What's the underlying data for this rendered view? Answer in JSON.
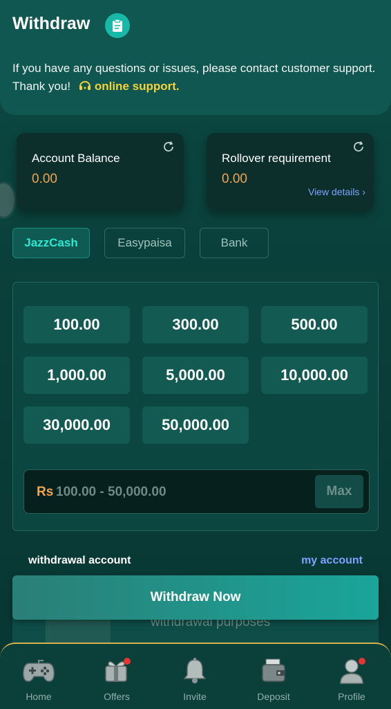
{
  "header": {
    "title": "Withdraw",
    "title_icon": "clipboard-icon",
    "message": "If you have any questions or issues, please contact customer support. Thank you!",
    "support_link": "online support",
    "support_link_suffix": "."
  },
  "balances": {
    "account_balance_label": "Account Balance",
    "account_balance_value": "0.00",
    "rollover_label": "Rollover requirement",
    "rollover_value": "0.00",
    "view_details": "View details"
  },
  "methods": {
    "tabs": [
      "JazzCash",
      "Easypaisa",
      "Bank"
    ],
    "active": "JazzCash"
  },
  "amounts": {
    "presets": [
      "100.00",
      "300.00",
      "500.00",
      "1,000.00",
      "5,000.00",
      "10,000.00",
      "30,000.00",
      "50,000.00"
    ],
    "currency": "Rs",
    "placeholder_range": "100.00 - 50,000.00",
    "max_label": "Max"
  },
  "withdrawal_account": {
    "label": "withdrawal account",
    "link": "my account",
    "hidden_text": "withdrawal purposes"
  },
  "withdraw_button": "Withdraw Now",
  "bottom_nav": {
    "items": [
      {
        "label": "Home",
        "icon": "gamepad-icon"
      },
      {
        "label": "Offers",
        "icon": "gift-icon"
      },
      {
        "label": "Invite",
        "icon": "bell-icon"
      },
      {
        "label": "Deposit",
        "icon": "wallet-icon"
      },
      {
        "label": "Profile",
        "icon": "user-icon"
      }
    ]
  },
  "colors": {
    "accent": "#17b8a8",
    "balance_value": "#f0a552",
    "link": "#7ea2ff",
    "support_link": "#f3d23a",
    "notification_dot": "#e83333"
  }
}
